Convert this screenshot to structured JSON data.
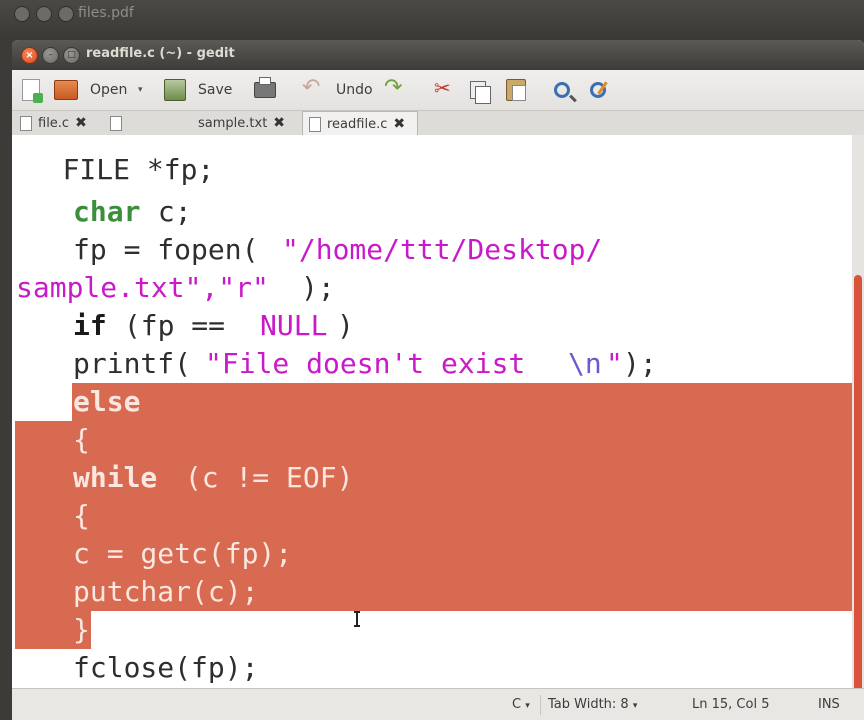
{
  "background_window": {
    "title": "files.pdf"
  },
  "window": {
    "title": "readfile.c (~) - gedit"
  },
  "toolbar": {
    "open_label": "Open",
    "save_label": "Save",
    "undo_label": "Undo",
    "dropdown_glyph": "▾"
  },
  "tabs": [
    {
      "label": "file.c",
      "active": false
    },
    {
      "label": "sample.txt",
      "active": false
    },
    {
      "label": "readfile.c",
      "active": true
    }
  ],
  "code_lines": [
    {
      "text": "   FILE *fp;"
    },
    {
      "text": "   char c;"
    },
    {
      "text": "   fp = fopen(\"/home/ttt/Desktop/"
    },
    {
      "text": "sample.txt\",\"r\");"
    },
    {
      "text": "   if (fp == NULL)"
    },
    {
      "text": "   printf(\"File doesn't exist\\n\");"
    },
    {
      "text": "   else"
    },
    {
      "text": "   {"
    },
    {
      "text": "   while (c != EOF)"
    },
    {
      "text": "   {"
    },
    {
      "text": "   c = getc(fp);"
    },
    {
      "text": "   putchar(c);"
    },
    {
      "text": "   }"
    },
    {
      "text": "   fclose(fp);"
    },
    {
      "text": "   }"
    }
  ],
  "statusbar": {
    "language": "C",
    "tab_width": "Tab Width:  8",
    "position": "Ln 15, Col 5",
    "mode": "INS"
  },
  "colors": {
    "selection": "#d96a52",
    "keyword": "#3b8f3b",
    "string": "#c81ac8"
  }
}
